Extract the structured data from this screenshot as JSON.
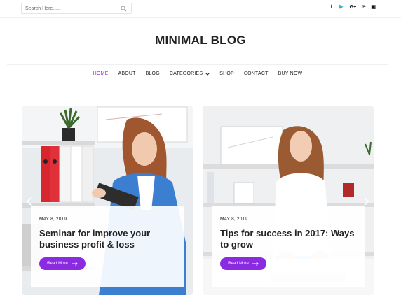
{
  "search": {
    "placeholder": "Search Here....."
  },
  "social": [
    "f",
    "🐦",
    "G+",
    "℗",
    "▣"
  ],
  "site": {
    "title": "MINIMAL BLOG"
  },
  "nav": {
    "items": [
      {
        "label": "HOME",
        "active": true
      },
      {
        "label": "ABOUT"
      },
      {
        "label": "BLOG"
      },
      {
        "label": "CATEGORIES"
      },
      {
        "label": "SHOP"
      },
      {
        "label": "CONTACT"
      },
      {
        "label": "BUY NOW"
      }
    ]
  },
  "posts": [
    {
      "date": "MAY 8, 2019",
      "title": "Seminar for improve your business profit & loss",
      "button": "Read More"
    },
    {
      "date": "MAY 8, 2019",
      "title": "Tips for success in 2017: Ways to grow",
      "button": "Read More"
    }
  ],
  "colors": {
    "accent": "#8a2be2"
  }
}
